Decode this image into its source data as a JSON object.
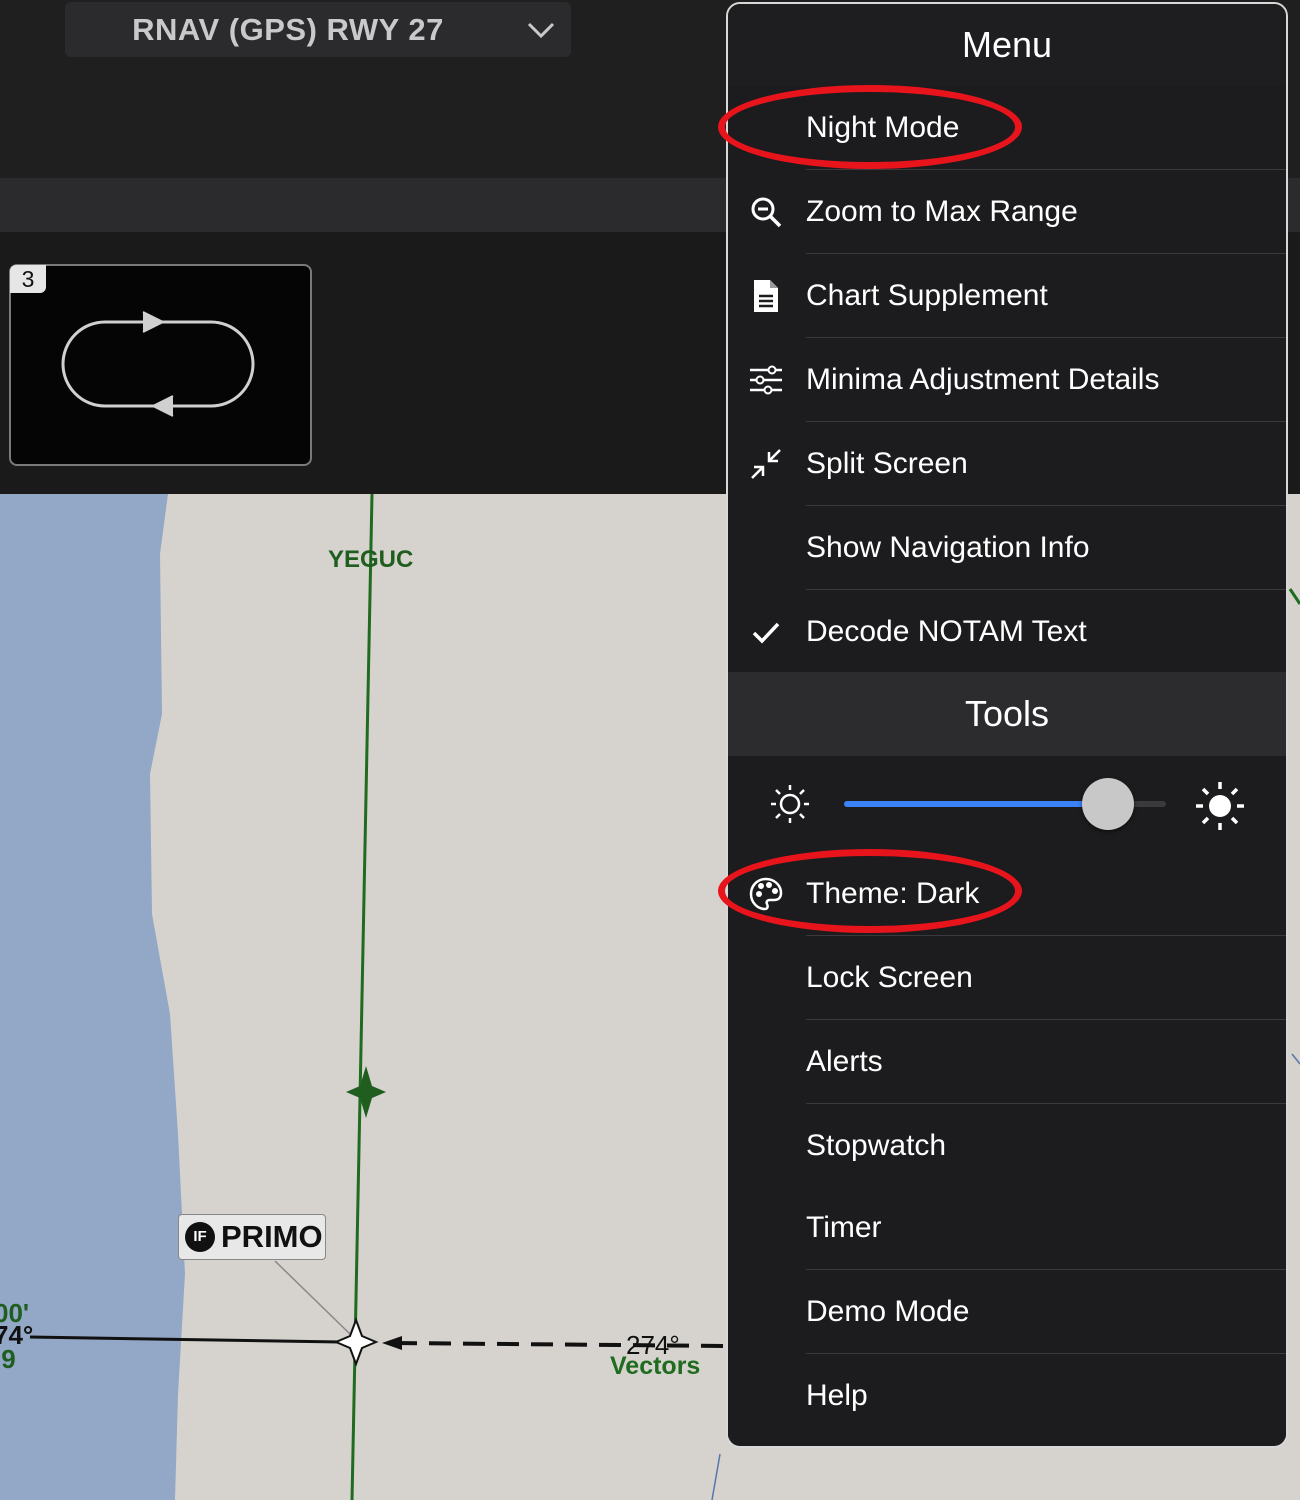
{
  "header": {
    "procedure": "RNAV (GPS) RWY 27"
  },
  "thumbnail": {
    "number": "3"
  },
  "map": {
    "fix_yegoc": "YEGUC",
    "fix_primo": "PRIMO",
    "primo_badge": "IF",
    "course": "274°",
    "course_note": "Vectors",
    "left_alt": "00'",
    "left_course": "74°",
    "left_dist": ".9"
  },
  "menu": {
    "title": "Menu",
    "items": [
      {
        "label": "Night Mode",
        "icon": ""
      },
      {
        "label": "Zoom to Max Range",
        "icon": "magnifier-minus-icon"
      },
      {
        "label": "Chart Supplement",
        "icon": "document-icon"
      },
      {
        "label": "Minima Adjustment Details",
        "icon": "sliders-icon"
      },
      {
        "label": "Split Screen",
        "icon": "collapse-arrows-icon"
      },
      {
        "label": "Show Navigation Info",
        "icon": ""
      },
      {
        "label": "Decode NOTAM Text",
        "icon": "checkmark-icon",
        "checked": true
      }
    ]
  },
  "tools": {
    "title": "Tools",
    "brightness": 0.82,
    "items": [
      {
        "label": "Theme: Dark",
        "icon": "palette-icon"
      },
      {
        "label": "Lock Screen"
      },
      {
        "label": "Alerts"
      },
      {
        "label": "Stopwatch"
      },
      {
        "label": "Timer"
      },
      {
        "label": "Demo Mode"
      },
      {
        "label": "Help"
      }
    ]
  },
  "colors": {
    "accent": "#3b82f6",
    "annotation": "#e8141c",
    "route": "#1f6b1f"
  }
}
